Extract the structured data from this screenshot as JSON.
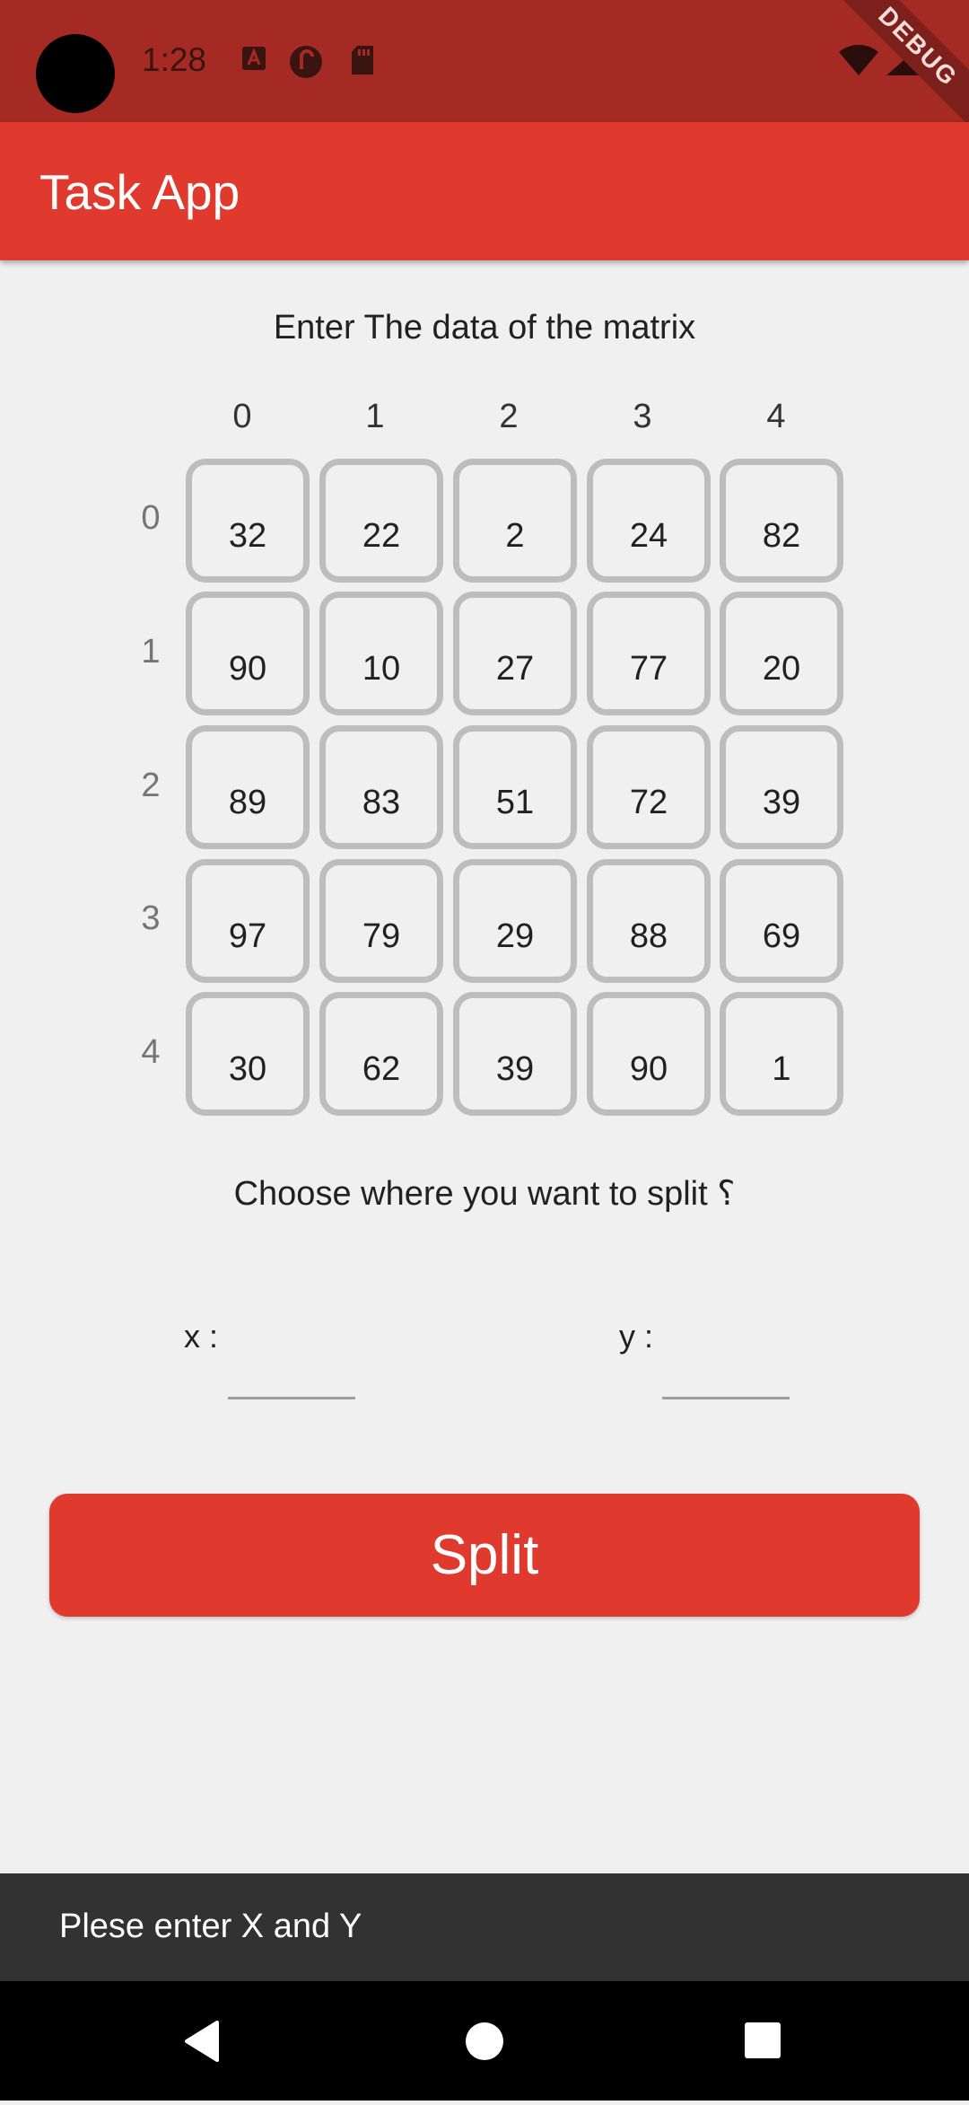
{
  "status_bar": {
    "time": "1:28",
    "notification_icons": [
      "adobe-acrobat-icon",
      "pocketcasts-icon",
      "sd-card-icon"
    ],
    "system_icons": [
      "wifi-icon",
      "signal-icon",
      "battery-icon"
    ],
    "debug_banner": "DEBUG"
  },
  "app_bar": {
    "title": "Task App"
  },
  "matrix": {
    "instructions": "Enter The data of the matrix",
    "column_labels": [
      "0",
      "1",
      "2",
      "3",
      "4"
    ],
    "row_labels": [
      "0",
      "1",
      "2",
      "3",
      "4"
    ],
    "values": [
      [
        "32",
        "22",
        "2",
        "24",
        "82"
      ],
      [
        "90",
        "10",
        "27",
        "77",
        "20"
      ],
      [
        "89",
        "83",
        "51",
        "72",
        "39"
      ],
      [
        "97",
        "79",
        "29",
        "88",
        "69"
      ],
      [
        "30",
        "62",
        "39",
        "90",
        "1"
      ]
    ]
  },
  "split": {
    "prompt": "Choose where you want to split ؟",
    "x_label": "x :",
    "y_label": "y :",
    "x_value": "",
    "y_value": "",
    "button_label": "Split"
  },
  "snackbar": {
    "message": "Plese enter X and Y"
  },
  "nav_bar": {
    "buttons": [
      "back-icon",
      "home-icon",
      "recents-icon"
    ]
  },
  "colors": {
    "accent": "#e0392d",
    "status_bar": "#a52a23",
    "snackbar": "#323232",
    "cell_border": "#bdbdbd"
  }
}
